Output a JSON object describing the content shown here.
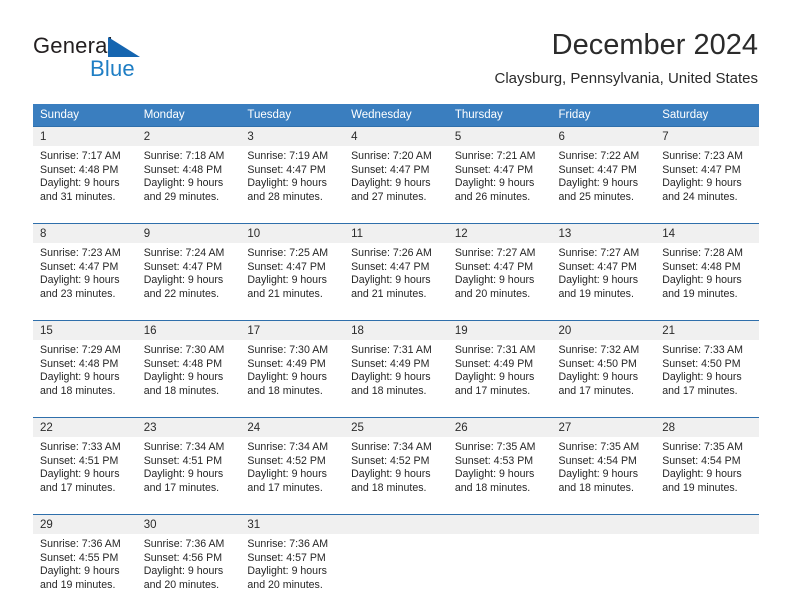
{
  "brand": {
    "name_part1": "General",
    "name_part2": "Blue",
    "accent_color": "#1f7ec4",
    "triangle_color": "#1565b0"
  },
  "header": {
    "title": "December 2024",
    "subtitle": "Claysburg, Pennsylvania, United States"
  },
  "calendar": {
    "header_bg": "#3a7ebf",
    "daynum_bg": "#f0f0f0",
    "row_border_color": "#2f6fab",
    "weekdays": [
      "Sunday",
      "Monday",
      "Tuesday",
      "Wednesday",
      "Thursday",
      "Friday",
      "Saturday"
    ],
    "weeks": [
      [
        {
          "day": "1",
          "sunrise": "Sunrise: 7:17 AM",
          "sunset": "Sunset: 4:48 PM",
          "daylight1": "Daylight: 9 hours",
          "daylight2": "and 31 minutes."
        },
        {
          "day": "2",
          "sunrise": "Sunrise: 7:18 AM",
          "sunset": "Sunset: 4:48 PM",
          "daylight1": "Daylight: 9 hours",
          "daylight2": "and 29 minutes."
        },
        {
          "day": "3",
          "sunrise": "Sunrise: 7:19 AM",
          "sunset": "Sunset: 4:47 PM",
          "daylight1": "Daylight: 9 hours",
          "daylight2": "and 28 minutes."
        },
        {
          "day": "4",
          "sunrise": "Sunrise: 7:20 AM",
          "sunset": "Sunset: 4:47 PM",
          "daylight1": "Daylight: 9 hours",
          "daylight2": "and 27 minutes."
        },
        {
          "day": "5",
          "sunrise": "Sunrise: 7:21 AM",
          "sunset": "Sunset: 4:47 PM",
          "daylight1": "Daylight: 9 hours",
          "daylight2": "and 26 minutes."
        },
        {
          "day": "6",
          "sunrise": "Sunrise: 7:22 AM",
          "sunset": "Sunset: 4:47 PM",
          "daylight1": "Daylight: 9 hours",
          "daylight2": "and 25 minutes."
        },
        {
          "day": "7",
          "sunrise": "Sunrise: 7:23 AM",
          "sunset": "Sunset: 4:47 PM",
          "daylight1": "Daylight: 9 hours",
          "daylight2": "and 24 minutes."
        }
      ],
      [
        {
          "day": "8",
          "sunrise": "Sunrise: 7:23 AM",
          "sunset": "Sunset: 4:47 PM",
          "daylight1": "Daylight: 9 hours",
          "daylight2": "and 23 minutes."
        },
        {
          "day": "9",
          "sunrise": "Sunrise: 7:24 AM",
          "sunset": "Sunset: 4:47 PM",
          "daylight1": "Daylight: 9 hours",
          "daylight2": "and 22 minutes."
        },
        {
          "day": "10",
          "sunrise": "Sunrise: 7:25 AM",
          "sunset": "Sunset: 4:47 PM",
          "daylight1": "Daylight: 9 hours",
          "daylight2": "and 21 minutes."
        },
        {
          "day": "11",
          "sunrise": "Sunrise: 7:26 AM",
          "sunset": "Sunset: 4:47 PM",
          "daylight1": "Daylight: 9 hours",
          "daylight2": "and 21 minutes."
        },
        {
          "day": "12",
          "sunrise": "Sunrise: 7:27 AM",
          "sunset": "Sunset: 4:47 PM",
          "daylight1": "Daylight: 9 hours",
          "daylight2": "and 20 minutes."
        },
        {
          "day": "13",
          "sunrise": "Sunrise: 7:27 AM",
          "sunset": "Sunset: 4:47 PM",
          "daylight1": "Daylight: 9 hours",
          "daylight2": "and 19 minutes."
        },
        {
          "day": "14",
          "sunrise": "Sunrise: 7:28 AM",
          "sunset": "Sunset: 4:48 PM",
          "daylight1": "Daylight: 9 hours",
          "daylight2": "and 19 minutes."
        }
      ],
      [
        {
          "day": "15",
          "sunrise": "Sunrise: 7:29 AM",
          "sunset": "Sunset: 4:48 PM",
          "daylight1": "Daylight: 9 hours",
          "daylight2": "and 18 minutes."
        },
        {
          "day": "16",
          "sunrise": "Sunrise: 7:30 AM",
          "sunset": "Sunset: 4:48 PM",
          "daylight1": "Daylight: 9 hours",
          "daylight2": "and 18 minutes."
        },
        {
          "day": "17",
          "sunrise": "Sunrise: 7:30 AM",
          "sunset": "Sunset: 4:49 PM",
          "daylight1": "Daylight: 9 hours",
          "daylight2": "and 18 minutes."
        },
        {
          "day": "18",
          "sunrise": "Sunrise: 7:31 AM",
          "sunset": "Sunset: 4:49 PM",
          "daylight1": "Daylight: 9 hours",
          "daylight2": "and 18 minutes."
        },
        {
          "day": "19",
          "sunrise": "Sunrise: 7:31 AM",
          "sunset": "Sunset: 4:49 PM",
          "daylight1": "Daylight: 9 hours",
          "daylight2": "and 17 minutes."
        },
        {
          "day": "20",
          "sunrise": "Sunrise: 7:32 AM",
          "sunset": "Sunset: 4:50 PM",
          "daylight1": "Daylight: 9 hours",
          "daylight2": "and 17 minutes."
        },
        {
          "day": "21",
          "sunrise": "Sunrise: 7:33 AM",
          "sunset": "Sunset: 4:50 PM",
          "daylight1": "Daylight: 9 hours",
          "daylight2": "and 17 minutes."
        }
      ],
      [
        {
          "day": "22",
          "sunrise": "Sunrise: 7:33 AM",
          "sunset": "Sunset: 4:51 PM",
          "daylight1": "Daylight: 9 hours",
          "daylight2": "and 17 minutes."
        },
        {
          "day": "23",
          "sunrise": "Sunrise: 7:34 AM",
          "sunset": "Sunset: 4:51 PM",
          "daylight1": "Daylight: 9 hours",
          "daylight2": "and 17 minutes."
        },
        {
          "day": "24",
          "sunrise": "Sunrise: 7:34 AM",
          "sunset": "Sunset: 4:52 PM",
          "daylight1": "Daylight: 9 hours",
          "daylight2": "and 17 minutes."
        },
        {
          "day": "25",
          "sunrise": "Sunrise: 7:34 AM",
          "sunset": "Sunset: 4:52 PM",
          "daylight1": "Daylight: 9 hours",
          "daylight2": "and 18 minutes."
        },
        {
          "day": "26",
          "sunrise": "Sunrise: 7:35 AM",
          "sunset": "Sunset: 4:53 PM",
          "daylight1": "Daylight: 9 hours",
          "daylight2": "and 18 minutes."
        },
        {
          "day": "27",
          "sunrise": "Sunrise: 7:35 AM",
          "sunset": "Sunset: 4:54 PM",
          "daylight1": "Daylight: 9 hours",
          "daylight2": "and 18 minutes."
        },
        {
          "day": "28",
          "sunrise": "Sunrise: 7:35 AM",
          "sunset": "Sunset: 4:54 PM",
          "daylight1": "Daylight: 9 hours",
          "daylight2": "and 19 minutes."
        }
      ],
      [
        {
          "day": "29",
          "sunrise": "Sunrise: 7:36 AM",
          "sunset": "Sunset: 4:55 PM",
          "daylight1": "Daylight: 9 hours",
          "daylight2": "and 19 minutes."
        },
        {
          "day": "30",
          "sunrise": "Sunrise: 7:36 AM",
          "sunset": "Sunset: 4:56 PM",
          "daylight1": "Daylight: 9 hours",
          "daylight2": "and 20 minutes."
        },
        {
          "day": "31",
          "sunrise": "Sunrise: 7:36 AM",
          "sunset": "Sunset: 4:57 PM",
          "daylight1": "Daylight: 9 hours",
          "daylight2": "and 20 minutes."
        },
        {
          "day": "",
          "sunrise": "",
          "sunset": "",
          "daylight1": "",
          "daylight2": ""
        },
        {
          "day": "",
          "sunrise": "",
          "sunset": "",
          "daylight1": "",
          "daylight2": ""
        },
        {
          "day": "",
          "sunrise": "",
          "sunset": "",
          "daylight1": "",
          "daylight2": ""
        },
        {
          "day": "",
          "sunrise": "",
          "sunset": "",
          "daylight1": "",
          "daylight2": ""
        }
      ]
    ]
  }
}
